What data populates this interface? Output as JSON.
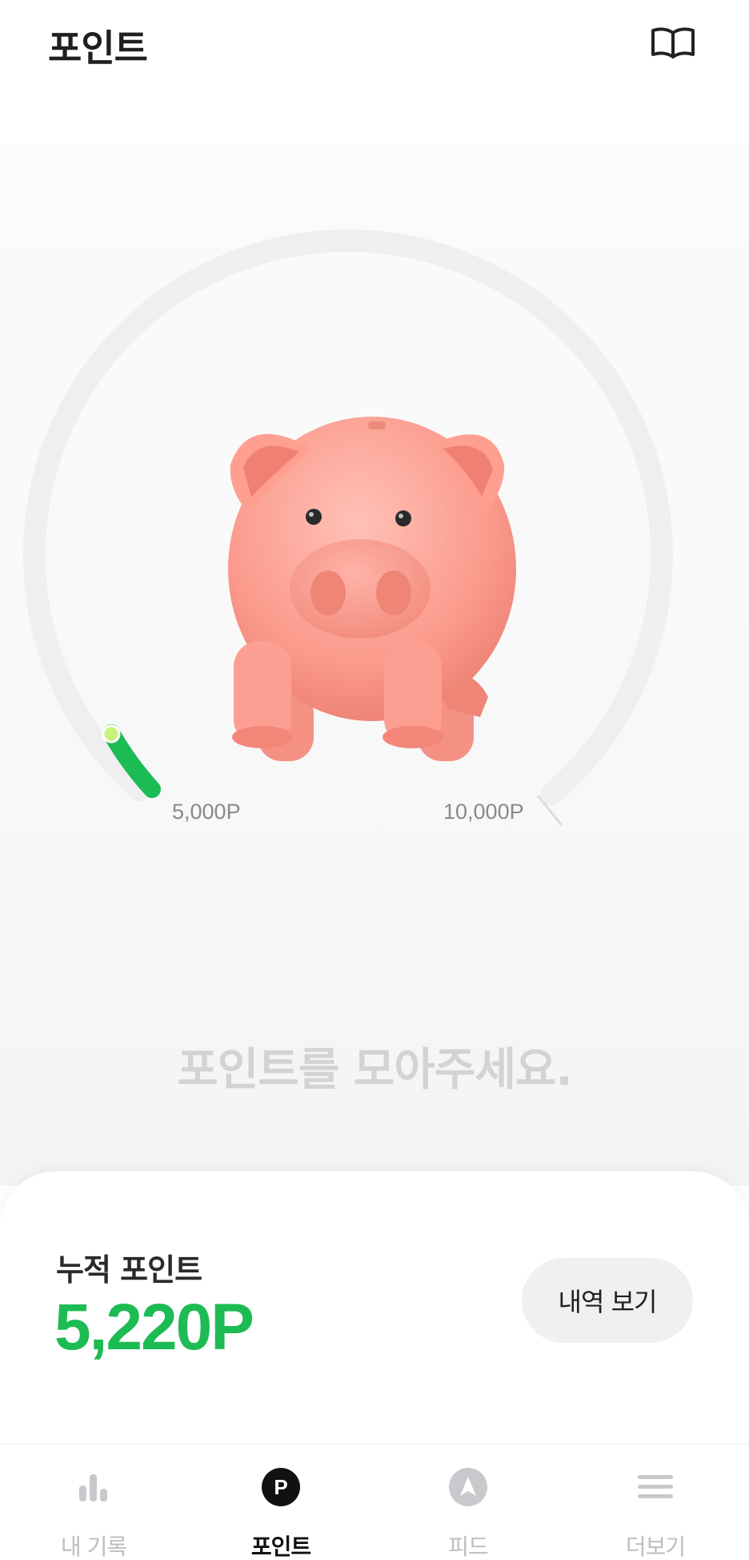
{
  "header": {
    "title": "포인트",
    "guide_icon": "open-book-icon"
  },
  "gauge": {
    "progress_fraction": 0.044,
    "start_label": "5,000P",
    "end_label": "10,000P",
    "progress_color": "#1dbb53",
    "track_color": "#efeff2"
  },
  "illustration": "piggy-bank",
  "message": "포인트를 모아주세요.",
  "summary": {
    "label": "누적 포인트",
    "value": "5,220P",
    "value_color": "#1dbb53",
    "history_button": "내역 보기"
  },
  "tabs": [
    {
      "label": "내 기록",
      "icon": "bar-chart-icon",
      "active": false
    },
    {
      "label": "포인트",
      "icon": "point-p-icon",
      "active": true
    },
    {
      "label": "피드",
      "icon": "navigation-arrow-icon",
      "active": false
    },
    {
      "label": "더보기",
      "icon": "menu-icon",
      "active": false
    }
  ]
}
